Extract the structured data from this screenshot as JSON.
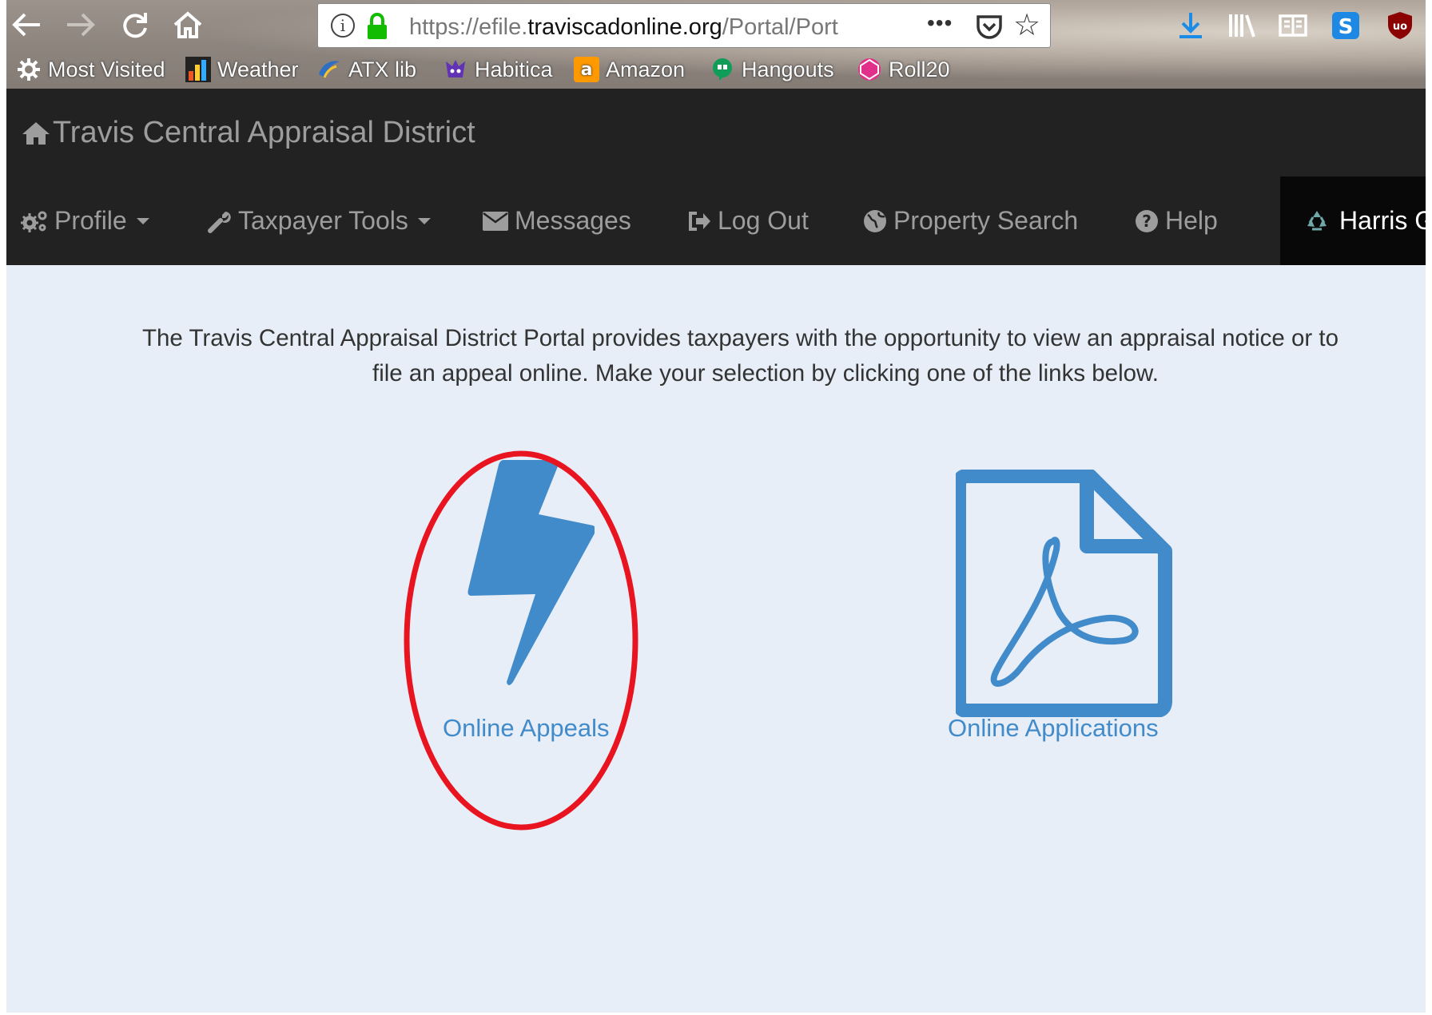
{
  "browser": {
    "url_prefix": "https://efile.",
    "url_domain": "traviscadonline.org",
    "url_suffix": "/Portal/Port",
    "more_label": "•••",
    "nav_icons": [
      "back-arrow-icon",
      "forward-arrow-icon",
      "reload-icon",
      "home-icon"
    ],
    "toolbar_icons": [
      "download-icon",
      "library-icon",
      "reader-view-icon",
      "skype-icon",
      "ublock-icon"
    ],
    "bookmarks": [
      {
        "label": "Most Visited",
        "icon": "gear-icon"
      },
      {
        "label": "Weather",
        "icon": "weather-underground-icon"
      },
      {
        "label": "ATX lib",
        "icon": "library-bird-icon"
      },
      {
        "label": "Habitica",
        "icon": "habitica-icon"
      },
      {
        "label": "Amazon",
        "icon": "amazon-icon"
      },
      {
        "label": "Hangouts",
        "icon": "hangouts-icon"
      },
      {
        "label": "Roll20",
        "icon": "roll20-icon"
      }
    ]
  },
  "site": {
    "brand": "Travis Central Appraisal District",
    "menu": {
      "profile": "Profile",
      "taxpayer_tools": "Taxpayer Tools",
      "messages": "Messages",
      "logout": "Log Out",
      "property_search": "Property Search",
      "help": "Help",
      "harris": "Harris G"
    }
  },
  "main": {
    "intro_line1": "The Travis Central Appraisal District Portal provides taxpayers with the opportunity to view an appraisal notice or to",
    "intro_line2": "file an appeal online. Make your selection by clicking one of the links below.",
    "tiles": [
      {
        "label": "Online Appeals",
        "icon": "lightning-bolt-icon"
      },
      {
        "label": "Online Applications",
        "icon": "pdf-file-icon"
      }
    ]
  },
  "colors": {
    "navbar_bg": "#222222",
    "navbar_text": "#9d9d9d",
    "page_bg": "#e7eef7",
    "link_blue": "#428bca",
    "annotation_red": "#e8141f"
  }
}
